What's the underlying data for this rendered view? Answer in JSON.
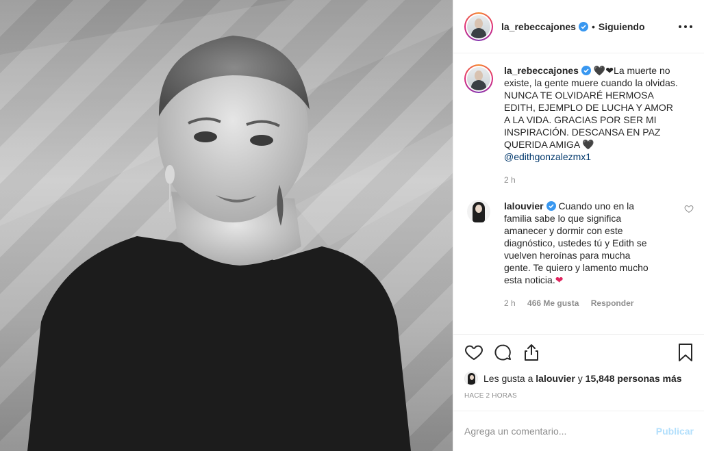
{
  "header": {
    "username": "la_rebeccajones",
    "separator": "•",
    "follow_status": "Siguiendo"
  },
  "caption": {
    "username": "la_rebeccajones",
    "emoji_prefix": "🖤❤",
    "text": "La muerte no existe, la gente muere cuando la olvidas. NUNCA TE OLVIDARÉ HERMOSA EDITH, EJEMPLO DE LUCHA Y AMOR A LA VIDA. GRACIAS POR SER MI INSPIRACIÓN. DESCANSA EN PAZ QUERIDA AMIGA",
    "emoji_suffix": "🖤",
    "mention": "@edithgonzalezmx1",
    "time": "2 h"
  },
  "comment": {
    "username": "lalouvier",
    "text": "Cuando uno en la familia sabe lo que significa amanecer y dormir con este diagnóstico, ustedes tú y Edith se vuelven heroínas para mucha gente. Te quiero y lamento mucho esta noticia.",
    "emoji": "❤",
    "time": "2 h",
    "likes": "466 Me gusta",
    "reply": "Responder"
  },
  "likes": {
    "prefix": "Les gusta a",
    "user": "lalouvier",
    "middle": "y",
    "count": "15,848 personas más"
  },
  "post_time": "HACE 2 HORAS",
  "add_comment": {
    "placeholder": "Agrega un comentario...",
    "publish": "Publicar"
  },
  "colors": {
    "verified": "#3897f0",
    "mention": "#00376b",
    "publish_disabled": "#b2dffc",
    "meta": "#8e8e8e"
  }
}
